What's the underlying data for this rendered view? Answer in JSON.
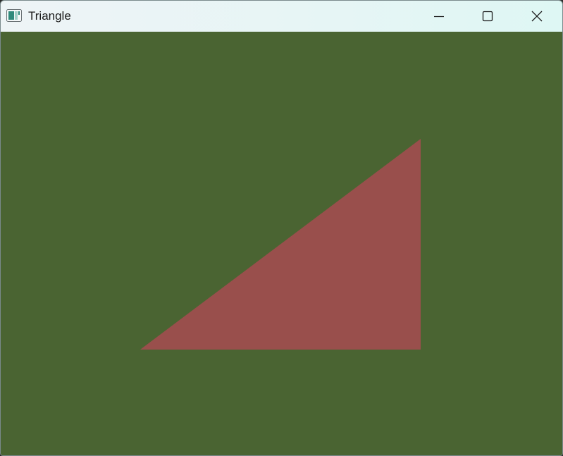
{
  "window": {
    "title": "Triangle",
    "title_icon": "app-window-icon",
    "controls": {
      "minimize_icon": "minimize-icon",
      "maximize_icon": "maximize-icon",
      "close_icon": "close-icon"
    }
  },
  "scene": {
    "background_color": "#4a6432",
    "shape": "right-triangle",
    "fill_color": "#994f4c"
  }
}
